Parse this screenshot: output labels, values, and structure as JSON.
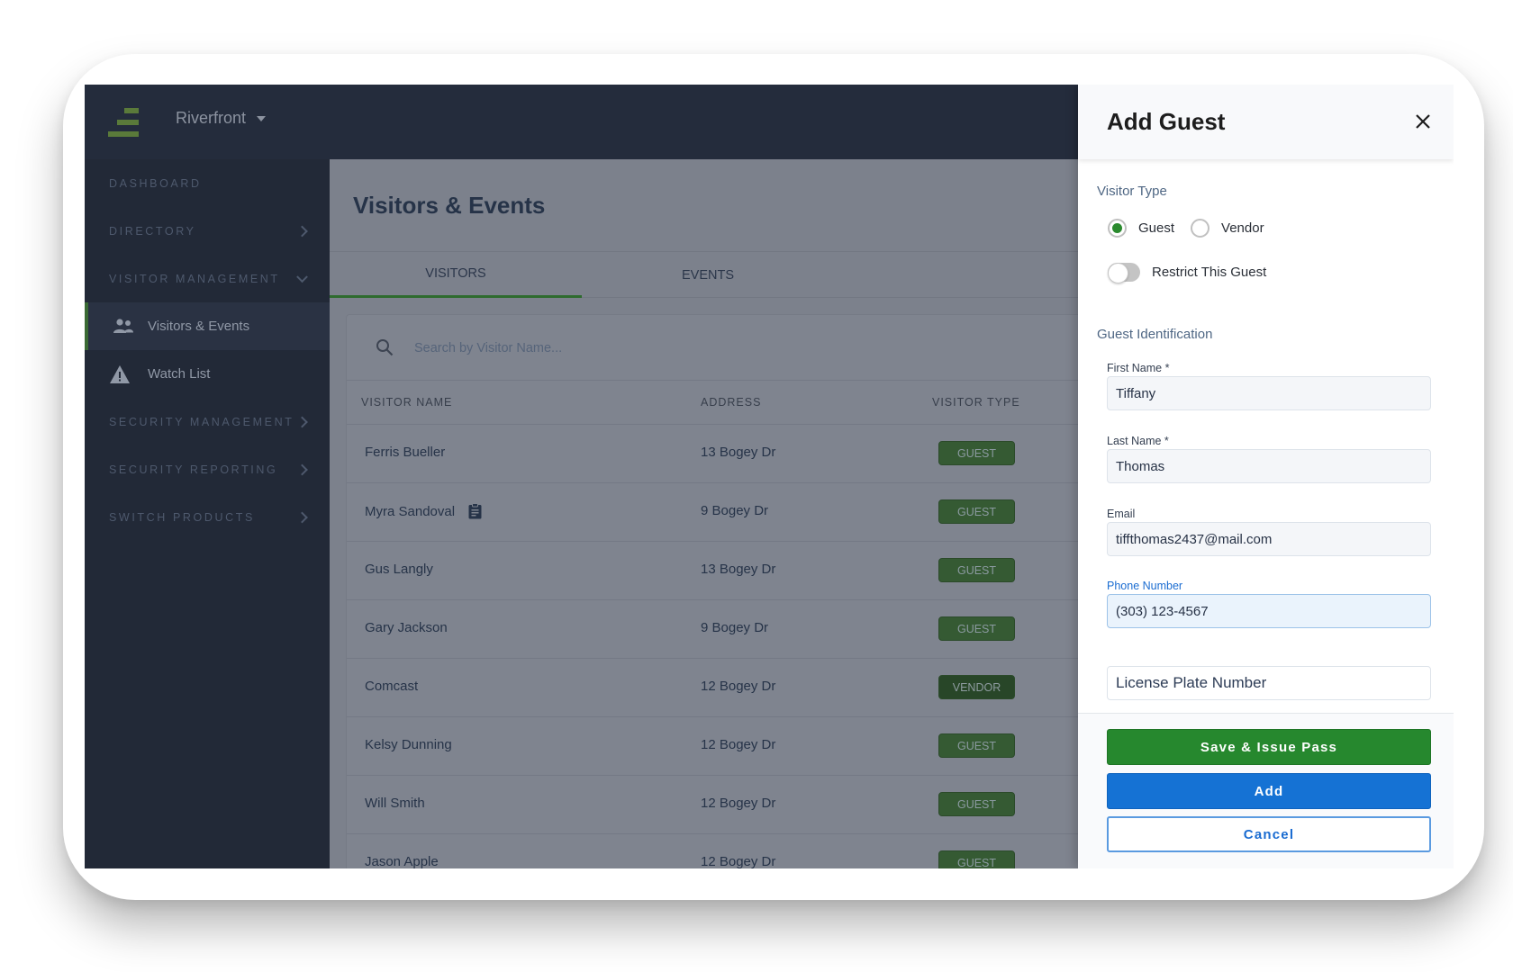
{
  "header": {
    "site_name": "Riverfront",
    "logo_icon": "stacked-bars-logo",
    "site_dropdown_icon": "caret-down-icon"
  },
  "sidebar": {
    "sections": [
      {
        "label": "DASHBOARD",
        "chevron": "none"
      },
      {
        "label": "DIRECTORY",
        "chevron": "right"
      },
      {
        "label": "VISITOR MANAGEMENT",
        "chevron": "down"
      },
      {
        "label": "SECURITY MANAGEMENT",
        "chevron": "right"
      },
      {
        "label": "SECURITY REPORTING",
        "chevron": "right"
      },
      {
        "label": "SWITCH PRODUCTS",
        "chevron": "right"
      }
    ],
    "items": [
      {
        "label": "Visitors & Events",
        "icon": "people-icon",
        "active": true
      },
      {
        "label": "Watch List",
        "icon": "warning-triangle-icon",
        "active": false
      }
    ]
  },
  "main": {
    "page_title": "Visitors & Events",
    "tabs": [
      {
        "label": "VISITORS",
        "active": true
      },
      {
        "label": "EVENTS",
        "active": false
      }
    ],
    "search": {
      "placeholder": "Search by Visitor Name...",
      "value": ""
    },
    "table": {
      "columns": [
        "VISITOR NAME",
        "ADDRESS",
        "VISITOR TYPE"
      ],
      "rows": [
        {
          "name": "Ferris Bueller",
          "address": "13 Bogey Dr",
          "type": "GUEST",
          "has_note": false
        },
        {
          "name": "Myra Sandoval",
          "address": "9 Bogey Dr",
          "type": "GUEST",
          "has_note": true
        },
        {
          "name": "Gus Langly",
          "address": "13 Bogey Dr",
          "type": "GUEST",
          "has_note": false
        },
        {
          "name": "Gary Jackson",
          "address": "9 Bogey Dr",
          "type": "GUEST",
          "has_note": false
        },
        {
          "name": "Comcast",
          "address": "12 Bogey Dr",
          "type": "VENDOR",
          "has_note": false
        },
        {
          "name": "Kelsy Dunning",
          "address": "12 Bogey Dr",
          "type": "GUEST",
          "has_note": false
        },
        {
          "name": "Will Smith",
          "address": "12 Bogey Dr",
          "type": "GUEST",
          "has_note": false
        },
        {
          "name": "Jason Apple",
          "address": "12 Bogey Dr",
          "type": "GUEST",
          "has_note": false
        }
      ]
    }
  },
  "panel": {
    "title": "Add Guest",
    "close_icon": "close-icon",
    "visitor_type_label": "Visitor Type",
    "visitor_type_options": [
      {
        "label": "Guest",
        "checked": true
      },
      {
        "label": "Vendor",
        "checked": false
      }
    ],
    "restrict_toggle": {
      "label": "Restrict This Guest",
      "on": false
    },
    "identification_label": "Guest Identification",
    "fields": {
      "first_name": {
        "label": "First Name *",
        "value": "Tiffany"
      },
      "last_name": {
        "label": "Last Name *",
        "value": "Thomas"
      },
      "email": {
        "label": "Email",
        "value": "tiffthomas2437@mail.com"
      },
      "phone": {
        "label": "Phone Number",
        "value": "(303) 123-4567",
        "focused": true
      },
      "license_plate": {
        "placeholder": "License Plate Number",
        "value": ""
      }
    },
    "buttons": {
      "save_issue": "Save & Issue Pass",
      "add": "Add",
      "cancel": "Cancel"
    }
  },
  "colors": {
    "sidebar_bg": "#222937",
    "accent_green": "#26882e",
    "accent_blue": "#1572d4",
    "badge_green": "#355a33"
  }
}
